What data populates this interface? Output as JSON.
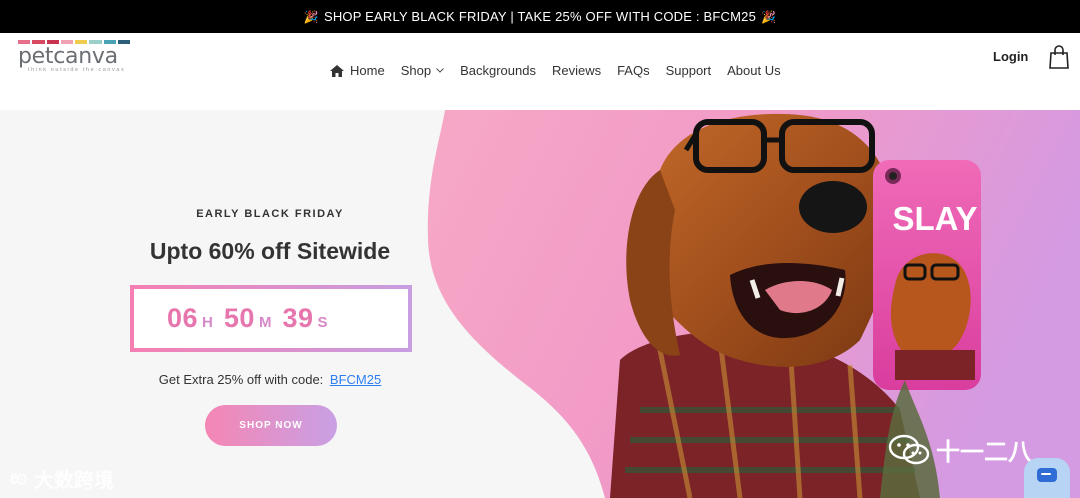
{
  "announcement": {
    "text": "SHOP EARLY BLACK FRIDAY | TAKE 25% OFF WITH CODE : BFCM25",
    "emoji": "🎉"
  },
  "brand": {
    "name": "petcanva",
    "tagline": "think outside the canvas",
    "stripe_colors": [
      "#e86f89",
      "#d94a62",
      "#c93350",
      "#f0a1b3",
      "#f1cc4e",
      "#9bd0c8",
      "#4aa3b5",
      "#2c5f7c"
    ]
  },
  "nav": {
    "items": [
      {
        "label": "Home",
        "icon": "home-icon"
      },
      {
        "label": "Shop",
        "icon": "chevron-down-icon"
      },
      {
        "label": "Backgrounds"
      },
      {
        "label": "Reviews"
      },
      {
        "label": "FAQs"
      },
      {
        "label": "Support"
      },
      {
        "label": "About Us"
      }
    ],
    "login": "Login",
    "cart_icon": "shopping-bag-icon"
  },
  "hero": {
    "eyebrow": "EARLY BLACK FRIDAY",
    "headline": "Upto 60% off Sitewide",
    "countdown": {
      "hours": "06",
      "hours_unit": "H",
      "minutes": "50",
      "minutes_unit": "M",
      "seconds": "39",
      "seconds_unit": "S"
    },
    "promo_text": "Get Extra 25% off with code:",
    "promo_code": "BFCM25",
    "cta": "SHOP NOW",
    "phone_case_text": "SLAY",
    "gradient_colors": [
      "#f57fb2",
      "#c79ee2"
    ]
  },
  "watermarks": {
    "left": "大数跨境",
    "right": "十一二八"
  },
  "chat": {
    "icon": "chat-icon"
  }
}
